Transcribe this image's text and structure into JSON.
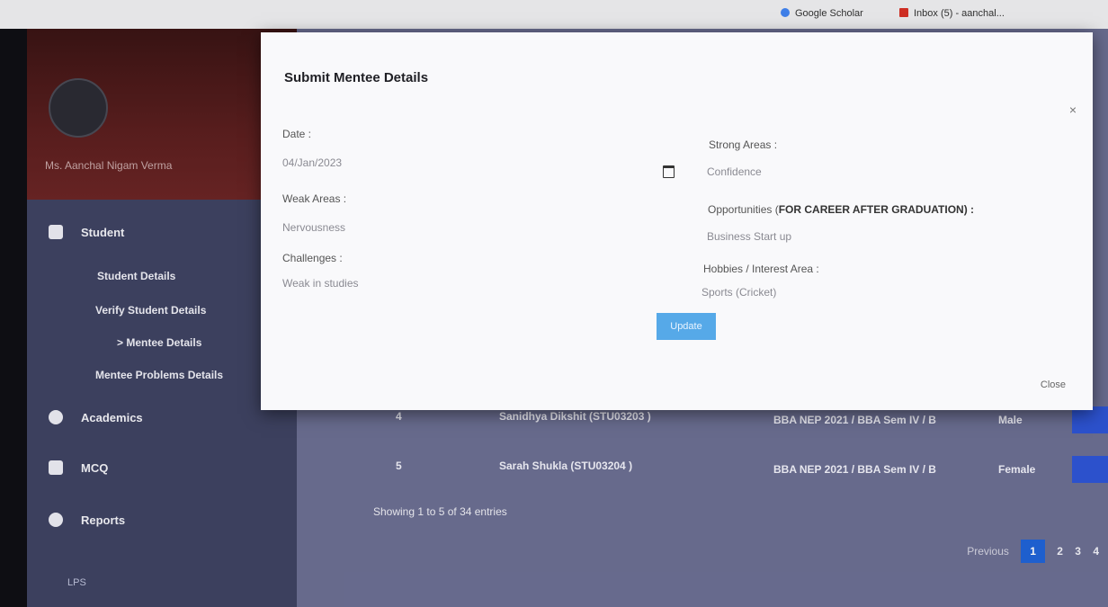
{
  "bookmarks": [
    {
      "label": "Google Scholar",
      "icon": "google-scholar-icon",
      "color": "#4285f4"
    },
    {
      "label": "Inbox (5) - aanchal...",
      "icon": "gmail-icon",
      "color": "#d93025"
    }
  ],
  "sidebar": {
    "user_name": "Ms. Aanchal Nigam Verma",
    "sections": [
      {
        "label": "Student",
        "icon": "student-icon"
      },
      {
        "label": "Academics",
        "icon": "academics-icon"
      },
      {
        "label": "MCQ",
        "icon": "mcq-icon"
      },
      {
        "label": "Reports",
        "icon": "reports-icon"
      }
    ],
    "student_sub": [
      "Student Details",
      "Verify Student Details",
      "> Mentee Details",
      "Mentee Problems Details"
    ],
    "plus_symbol": "+",
    "footer": "LPS"
  },
  "table": {
    "rows": [
      {
        "num": "4",
        "student": "Sanidhya Dikshit (STU03203 )",
        "course": "BBA NEP 2021 / BBA Sem IV / B",
        "gender": "Male"
      },
      {
        "num": "5",
        "student": "Sarah Shukla (STU03204 )",
        "course": "BBA NEP 2021 / BBA Sem IV / B",
        "gender": "Female"
      }
    ],
    "showing": "Showing 1 to 5 of 34 entries",
    "pagination": {
      "previous": "Previous",
      "pages": [
        "1",
        "2",
        "3",
        "4"
      ],
      "active": "1"
    }
  },
  "modal": {
    "title": "Submit Mentee Details",
    "close_x": "×",
    "date_label": "Date :",
    "date_value": "04/Jan/2023",
    "weak_label": "Weak Areas :",
    "weak_value": "Nervousness",
    "challenges_label": "Challenges :",
    "challenges_value": "Weak in studies",
    "strong_label": "Strong Areas :",
    "strong_value": "Confidence",
    "opportunities_label_prefix": "Opportunities (",
    "opportunities_label_bold": "FOR CAREER AFTER GRADUATION",
    "opportunities_label_suffix": ") :",
    "opportunities_value": "Business Start up",
    "hobbies_label": "Hobbies / Interest Area :",
    "hobbies_value": "Sports (Cricket)",
    "update_label": "Update",
    "close_label": "Close"
  }
}
